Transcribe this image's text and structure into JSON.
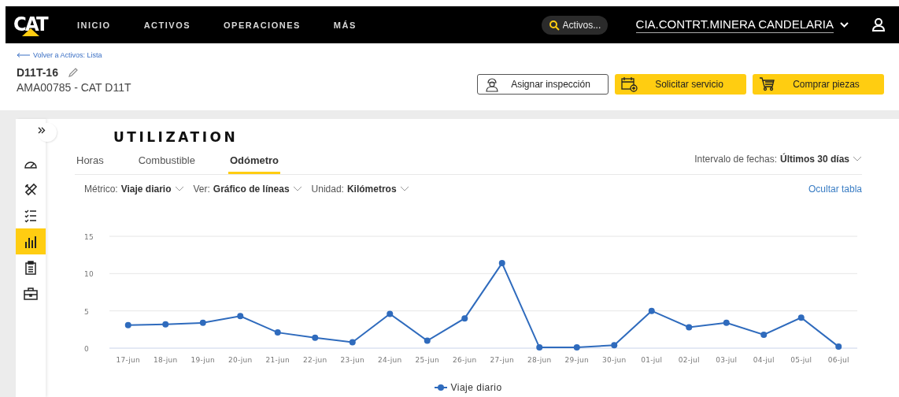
{
  "nav": {
    "logo": "CAT",
    "items": [
      {
        "label": "INICIO"
      },
      {
        "label": "ACTIVOS"
      },
      {
        "label": "OPERACIONES"
      },
      {
        "label": "MÁS"
      }
    ],
    "search": {
      "placeholder": "Activos..."
    },
    "company": "CIA.CONTRT.MINERA CANDELARIA"
  },
  "back_link": "Volver a Activos: Lista",
  "asset": {
    "title": "D11T-16",
    "subtitle": "AMA00785 - CAT D11T"
  },
  "actions": [
    {
      "kind": "outline",
      "label": "Asignar inspección"
    },
    {
      "kind": "primary",
      "label": "Solicitar servicio"
    },
    {
      "kind": "primary",
      "label": "Comprar piezas"
    }
  ],
  "sidebar": {
    "items": [
      {
        "selected": false
      },
      {
        "selected": false
      },
      {
        "selected": false
      },
      {
        "selected": true
      },
      {
        "selected": false
      },
      {
        "selected": false
      }
    ]
  },
  "panel": {
    "title": "UTILIZATION",
    "tabs": [
      {
        "label": "Horas",
        "selected": false
      },
      {
        "label": "Combustible",
        "selected": false
      },
      {
        "label": "Odómetro",
        "selected": true
      }
    ],
    "date_range": {
      "label": "Intervalo de fechas:",
      "value": "Últimos 30 días"
    },
    "filters": [
      {
        "label": "Métrico:",
        "value": "Viaje diario"
      },
      {
        "label": "Ver:",
        "value": "Gráfico de líneas"
      },
      {
        "label": "Unidad:",
        "value": "Kilómetros"
      }
    ],
    "hide_table": "Ocultar tabla",
    "chart_data": {
      "type": "line",
      "categories": [
        "17-jun",
        "18-jun",
        "19-jun",
        "20-jun",
        "21-jun",
        "22-jun",
        "23-jun",
        "24-jun",
        "25-jun",
        "26-jun",
        "27-jun",
        "28-jun",
        "29-jun",
        "30-jun",
        "01-jul",
        "02-jul",
        "03-jul",
        "04-jul",
        "05-jul",
        "06-jul"
      ],
      "yticks": [
        0,
        5,
        10,
        15
      ],
      "ylim": [
        0,
        15
      ],
      "series": [
        {
          "name": "Viaje diario",
          "color": "#2f6bbd",
          "marker": "circle",
          "values": [
            3.1,
            3.2,
            3.4,
            4.3,
            2.1,
            1.4,
            0.8,
            4.6,
            1.0,
            4.0,
            11.4,
            0.1,
            0.1,
            0.4,
            5.0,
            2.8,
            3.4,
            1.8,
            4.1,
            0.2
          ]
        }
      ]
    }
  }
}
